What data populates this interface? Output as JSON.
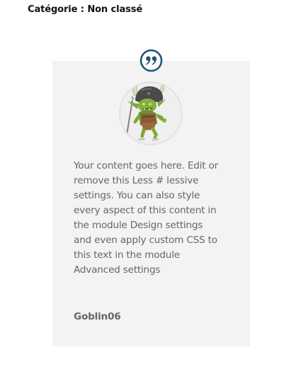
{
  "post": {
    "category_label": "Catégorie : Non classé"
  },
  "testimonial": {
    "quote_icon": "quote-icon",
    "avatar_icon": "goblin-avatar",
    "body": "Your content goes here. Edit or\nremove this Less # lessive\nsettings. You can also style\nevery aspect of this content in\nthe module Design settings\nand even apply custom CSS to\nthis text in the module\nAdvanced settings",
    "author": "Goblin06"
  },
  "colors": {
    "accent": "#1f5573",
    "card_background": "#f3f3f3",
    "body_text": "#666666"
  }
}
